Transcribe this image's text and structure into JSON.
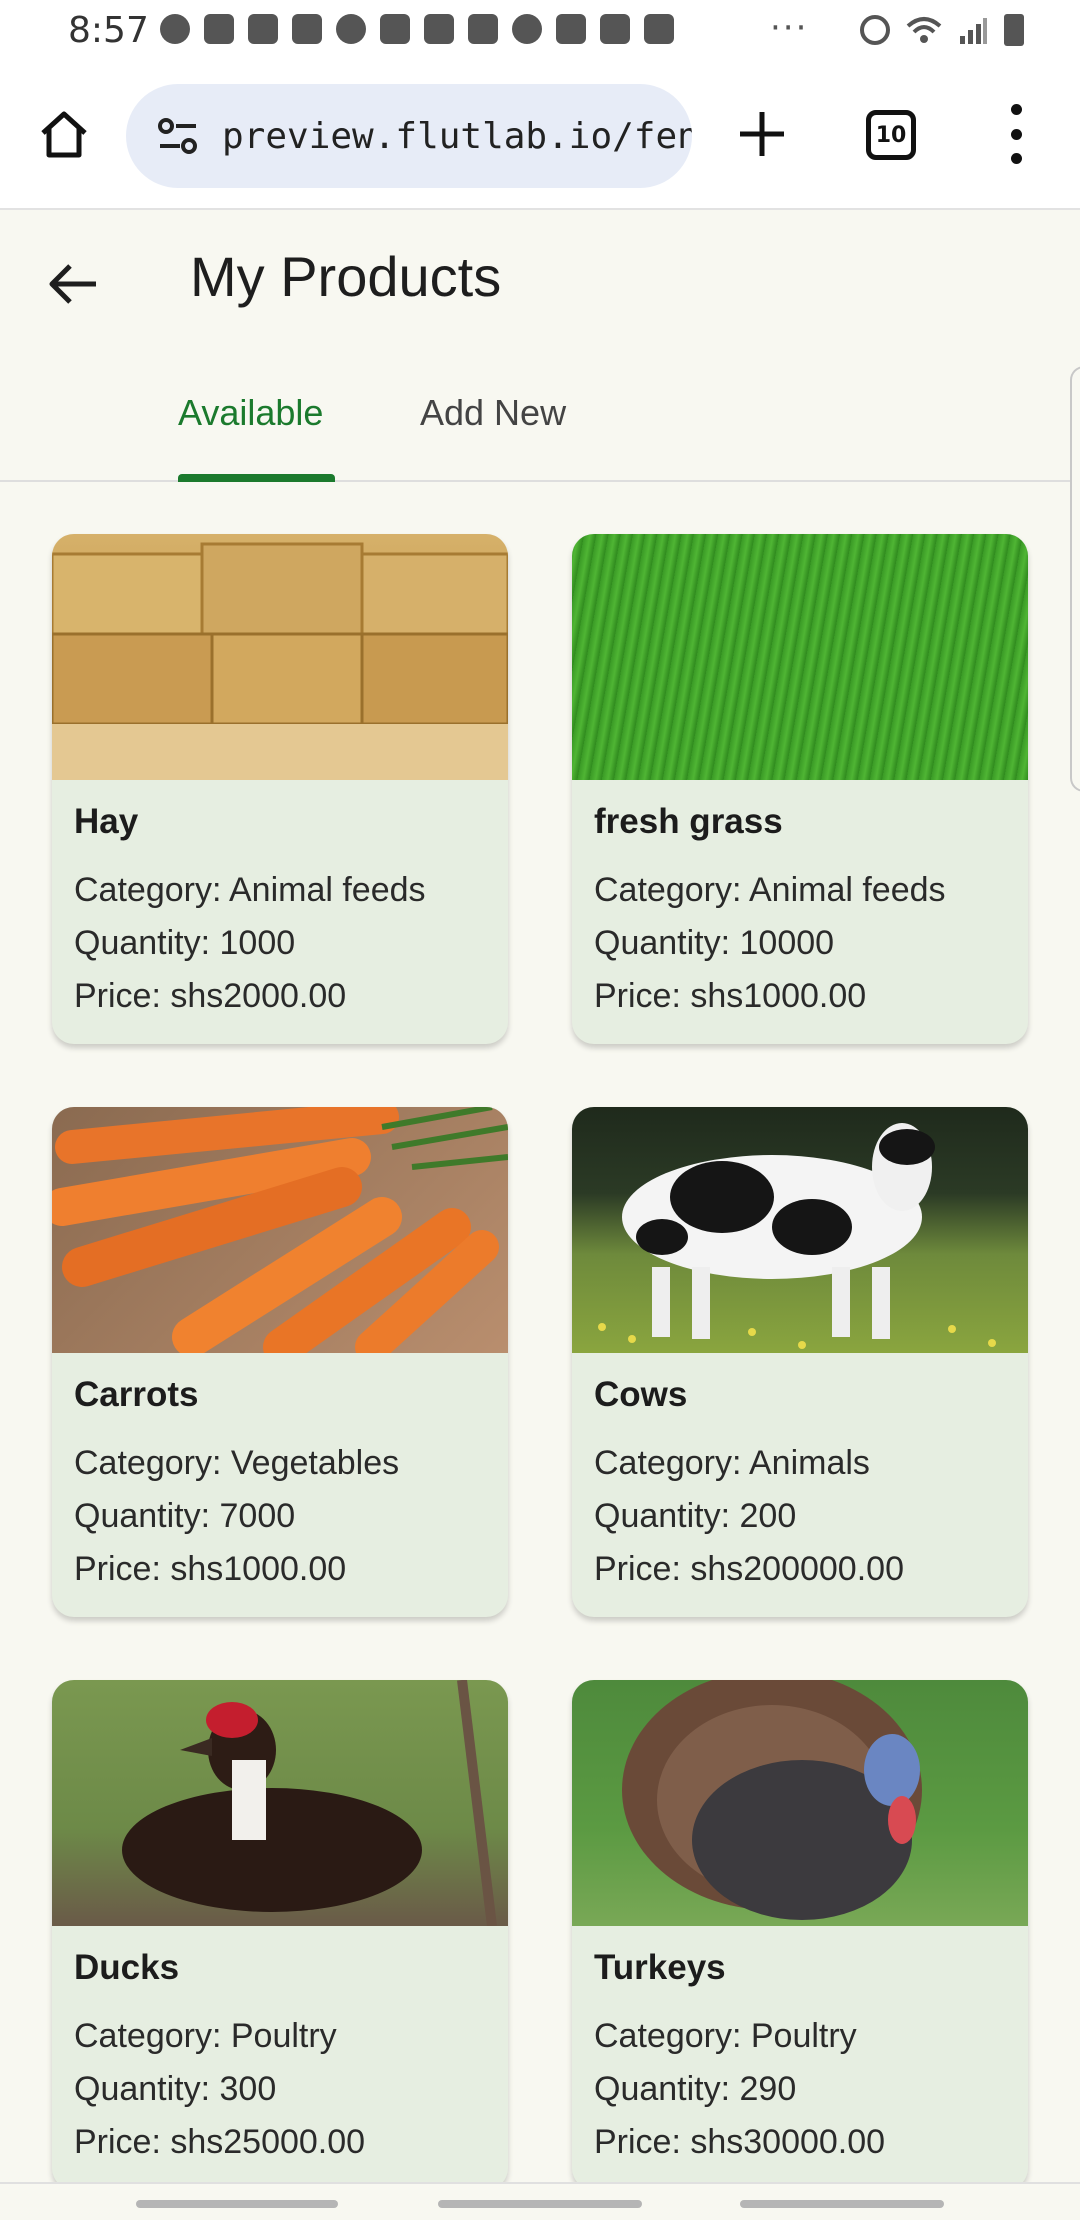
{
  "status_bar": {
    "time": "8:57",
    "more": "···"
  },
  "browser": {
    "url": "preview.flutlab.io/feni_",
    "tab_count": "10"
  },
  "app_bar": {
    "title": "My Products"
  },
  "tabs": [
    {
      "label": "Available",
      "selected": true
    },
    {
      "label": "Add New",
      "selected": false
    }
  ],
  "colors": {
    "accent": "#1b7a2d",
    "card_bg": "#e6eee1",
    "page_bg": "#f8f8f1"
  },
  "products": [
    {
      "name": "Hay",
      "category": "Category: Animal feeds",
      "quantity": "Quantity: 1000",
      "price": "Price: shs2000.00",
      "image": "hay-bales-image"
    },
    {
      "name": "fresh grass",
      "category": "Category: Animal feeds",
      "quantity": "Quantity: 10000",
      "price": "Price: shs1000.00",
      "image": "grass-field-image"
    },
    {
      "name": "Carrots",
      "category": "Category: Vegetables",
      "quantity": "Quantity: 7000",
      "price": "Price: shs1000.00",
      "image": "carrots-image"
    },
    {
      "name": "Cows",
      "category": "Category: Animals",
      "quantity": "Quantity: 200",
      "price": "Price: shs200000.00",
      "image": "cow-image"
    },
    {
      "name": "Ducks",
      "category": "Category: Poultry",
      "quantity": "Quantity: 300",
      "price": "Price: shs25000.00",
      "image": "duck-image"
    },
    {
      "name": "Turkeys",
      "category": "Category: Poultry",
      "quantity": "Quantity: 290",
      "price": "Price: shs30000.00",
      "image": "turkey-image"
    }
  ]
}
